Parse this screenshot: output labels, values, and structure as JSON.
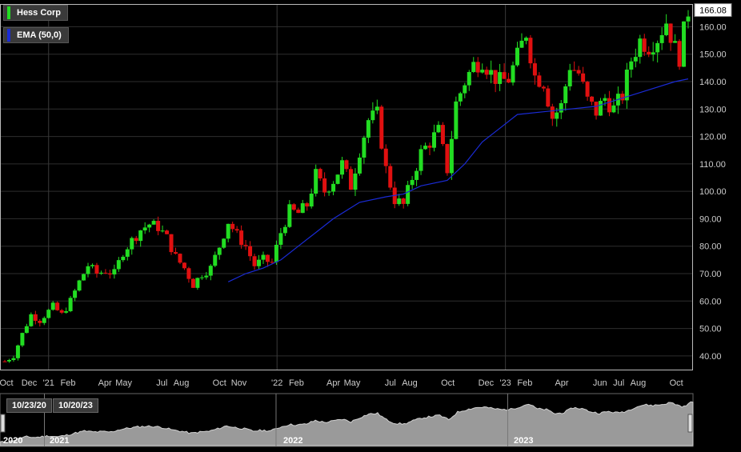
{
  "legend": {
    "symbol_label": "Hess Corp",
    "symbol_color": "#22dd22",
    "ema_label": "EMA (50,0)",
    "ema_color": "#1a2bd6"
  },
  "last_price_label": "166.08",
  "navigator": {
    "start_date": "10/23/20",
    "end_date": "10/20/23",
    "year_labels": [
      "2020",
      "2021",
      "2022",
      "2023"
    ]
  },
  "colors": {
    "up": "#22dd22",
    "down": "#e01010",
    "ema": "#1a2bd6",
    "grid": "#2e2e2e",
    "axis_text": "#cccccc"
  },
  "chart_data": {
    "type": "candlestick",
    "title": "Hess Corp",
    "ylim": [
      35,
      168
    ],
    "y_ticks": [
      40,
      50,
      60,
      70,
      80,
      90,
      100,
      110,
      120,
      130,
      140,
      150,
      160
    ],
    "y_tick_labels": [
      "40.00",
      "50.00",
      "60.00",
      "70.00",
      "80.00",
      "90.00",
      "100.00",
      "110.00",
      "120.00",
      "130.00",
      "140.00",
      "150.00",
      "160.00"
    ],
    "x_tick_labels": [
      "Oct",
      "Dec",
      "'21",
      "Feb",
      "Apr",
      "May",
      "Jul",
      "Aug",
      "Oct",
      "Nov",
      "'22",
      "Feb",
      "Apr",
      "May",
      "Jul",
      "Aug",
      "Oct",
      "Dec",
      "'23",
      "Feb",
      "Apr",
      "Jun",
      "Jul",
      "Aug",
      "Oct"
    ],
    "x_range": [
      "2020-10-23",
      "2023-10-20"
    ],
    "last_price": 166.08,
    "grid": true,
    "price_anchors": [
      [
        "2020-10-23",
        38
      ],
      [
        "2020-11-06",
        40
      ],
      [
        "2020-11-20",
        48
      ],
      [
        "2020-12-04",
        55
      ],
      [
        "2020-12-18",
        53
      ],
      [
        "2021-01-08",
        58
      ],
      [
        "2021-01-22",
        55
      ],
      [
        "2021-02-05",
        60
      ],
      [
        "2021-02-19",
        67
      ],
      [
        "2021-03-05",
        73
      ],
      [
        "2021-03-19",
        70
      ],
      [
        "2021-04-02",
        71
      ],
      [
        "2021-04-16",
        70
      ],
      [
        "2021-04-30",
        78
      ],
      [
        "2021-05-14",
        82
      ],
      [
        "2021-05-28",
        86
      ],
      [
        "2021-06-11",
        88
      ],
      [
        "2021-06-25",
        87
      ],
      [
        "2021-07-09",
        83
      ],
      [
        "2021-07-23",
        76
      ],
      [
        "2021-08-06",
        72
      ],
      [
        "2021-08-20",
        66
      ],
      [
        "2021-09-03",
        70
      ],
      [
        "2021-09-17",
        72
      ],
      [
        "2021-10-01",
        80
      ],
      [
        "2021-10-15",
        89
      ],
      [
        "2021-10-29",
        84
      ],
      [
        "2021-11-12",
        80
      ],
      [
        "2021-11-26",
        73
      ],
      [
        "2021-12-10",
        75
      ],
      [
        "2021-12-24",
        74
      ],
      [
        "2022-01-07",
        85
      ],
      [
        "2022-01-21",
        93
      ],
      [
        "2022-02-04",
        92
      ],
      [
        "2022-02-18",
        95
      ],
      [
        "2022-03-04",
        106
      ],
      [
        "2022-03-18",
        100
      ],
      [
        "2022-04-01",
        104
      ],
      [
        "2022-04-15",
        110
      ],
      [
        "2022-04-29",
        102
      ],
      [
        "2022-05-13",
        115
      ],
      [
        "2022-05-27",
        126
      ],
      [
        "2022-06-10",
        128
      ],
      [
        "2022-06-24",
        108
      ],
      [
        "2022-07-08",
        97
      ],
      [
        "2022-07-22",
        95
      ],
      [
        "2022-08-05",
        105
      ],
      [
        "2022-08-19",
        114
      ],
      [
        "2022-09-02",
        118
      ],
      [
        "2022-09-16",
        122
      ],
      [
        "2022-09-30",
        108
      ],
      [
        "2022-10-14",
        132
      ],
      [
        "2022-10-28",
        140
      ],
      [
        "2022-11-11",
        146
      ],
      [
        "2022-11-25",
        148
      ],
      [
        "2022-12-09",
        143
      ],
      [
        "2022-12-23",
        140
      ],
      [
        "2023-01-06",
        141
      ],
      [
        "2023-01-20",
        149
      ],
      [
        "2023-02-03",
        158
      ],
      [
        "2023-02-17",
        142
      ],
      [
        "2023-03-03",
        140
      ],
      [
        "2023-03-17",
        127
      ],
      [
        "2023-03-31",
        131
      ],
      [
        "2023-04-14",
        146
      ],
      [
        "2023-04-28",
        143
      ],
      [
        "2023-05-12",
        133
      ],
      [
        "2023-05-26",
        129
      ],
      [
        "2023-06-09",
        134
      ],
      [
        "2023-06-23",
        130
      ],
      [
        "2023-07-07",
        135
      ],
      [
        "2023-07-21",
        148
      ],
      [
        "2023-08-04",
        155
      ],
      [
        "2023-08-18",
        153
      ],
      [
        "2023-09-01",
        156
      ],
      [
        "2023-09-15",
        162
      ],
      [
        "2023-09-29",
        152
      ],
      [
        "2023-10-06",
        149
      ],
      [
        "2023-10-13",
        158
      ],
      [
        "2023-10-20",
        166
      ]
    ],
    "ema_anchors": [
      [
        "2021-10-15",
        67
      ],
      [
        "2021-11-12",
        70
      ],
      [
        "2021-12-10",
        72
      ],
      [
        "2022-01-07",
        75
      ],
      [
        "2022-02-04",
        80
      ],
      [
        "2022-03-04",
        85
      ],
      [
        "2022-04-01",
        90
      ],
      [
        "2022-05-13",
        96
      ],
      [
        "2022-06-24",
        98
      ],
      [
        "2022-07-22",
        99
      ],
      [
        "2022-08-19",
        102
      ],
      [
        "2022-09-30",
        104
      ],
      [
        "2022-10-28",
        110
      ],
      [
        "2022-11-25",
        118
      ],
      [
        "2022-12-23",
        123
      ],
      [
        "2023-01-20",
        128
      ],
      [
        "2023-03-03",
        129
      ],
      [
        "2023-04-14",
        130
      ],
      [
        "2023-05-26",
        131
      ],
      [
        "2023-07-07",
        134
      ],
      [
        "2023-08-18",
        137
      ],
      [
        "2023-09-29",
        140
      ],
      [
        "2023-10-20",
        141
      ]
    ]
  }
}
